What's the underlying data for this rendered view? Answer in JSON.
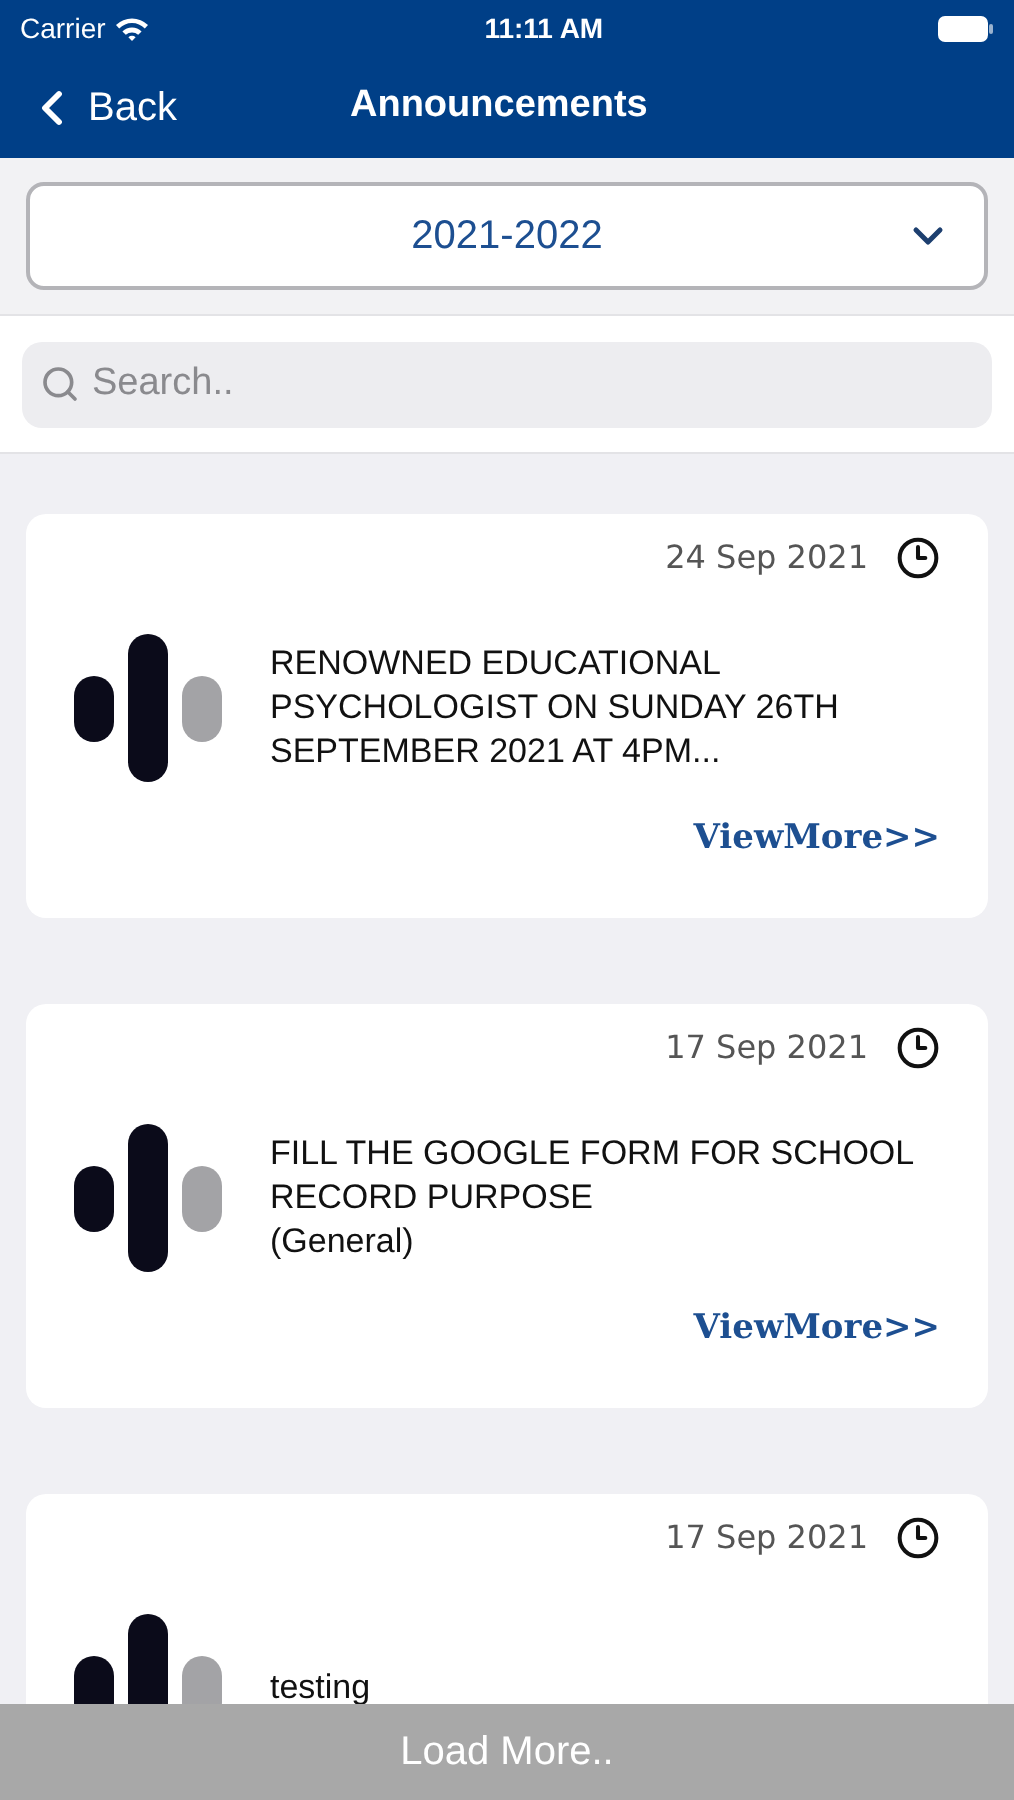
{
  "status_bar": {
    "carrier": "Carrier",
    "time": "11:11 AM"
  },
  "nav": {
    "back": "Back",
    "title": "Announcements"
  },
  "year_select": {
    "value": "2021-2022"
  },
  "search": {
    "placeholder": "Search.."
  },
  "announcements": [
    {
      "date": "24 Sep 2021",
      "title": "RENOWNED EDUCATIONAL PSYCHOLOGIST ON SUNDAY 26TH SEPTEMBER 2021 AT 4PM...",
      "view_more": "ViewMore>>"
    },
    {
      "date": "17 Sep 2021",
      "title": "FILL THE GOOGLE FORM FOR SCHOOL RECORD PURPOSE",
      "category": "(General)",
      "view_more": "ViewMore>>"
    },
    {
      "date": "17 Sep 2021",
      "title": "testing"
    }
  ],
  "load_more": "Load More.."
}
